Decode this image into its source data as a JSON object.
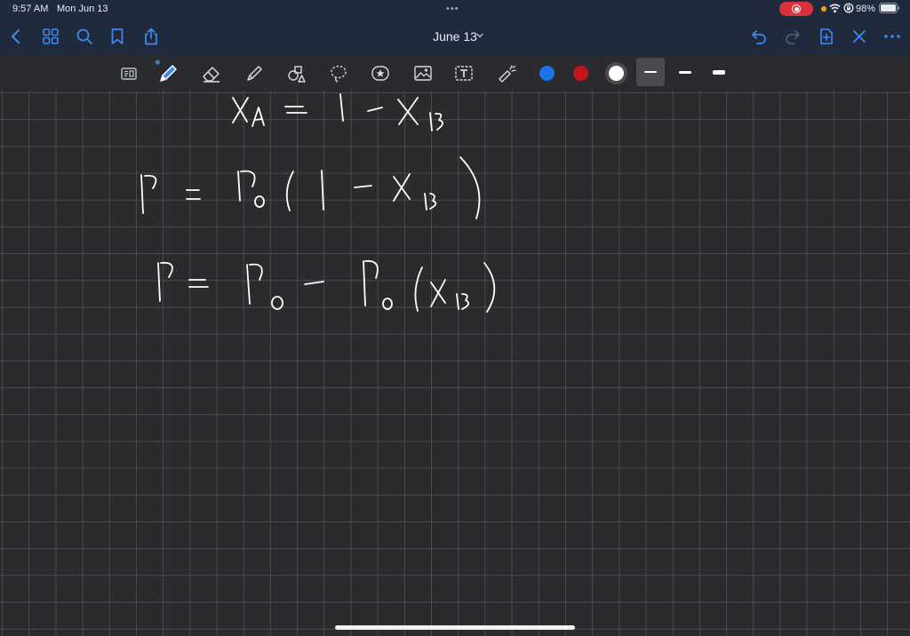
{
  "status_bar": {
    "time": "9:57 AM",
    "date": "Mon Jun 13",
    "battery": "98%"
  },
  "nav": {
    "title": "June 13",
    "left_icons": [
      "back-chevron-icon",
      "grid-icon",
      "search-icon",
      "bookmark-icon",
      "share-icon"
    ],
    "right_icons": [
      "undo-icon",
      "redo-icon",
      "add-page-icon",
      "close-icon",
      "more-icon"
    ]
  },
  "toolbar": {
    "tools": [
      "page-reader-icon",
      "pen-icon",
      "eraser-icon",
      "highlighter-icon",
      "shapes-icon",
      "lasso-icon",
      "sticker-icon",
      "image-icon",
      "text-icon",
      "laser-pointer-icon"
    ],
    "colors": [
      "#1a73e8",
      "#c0171d",
      "#ffffff"
    ],
    "selected_color": "#ffffff",
    "stroke_widths": [
      "thin",
      "medium",
      "thick"
    ],
    "selected_stroke": "thin"
  },
  "colors": {
    "nav_bg": "#1f2a3d",
    "accent": "#3d8bf2",
    "canvas_bg": "#2b2b2e",
    "grid": "#4b4b4f",
    "ink": "#ffffff"
  }
}
